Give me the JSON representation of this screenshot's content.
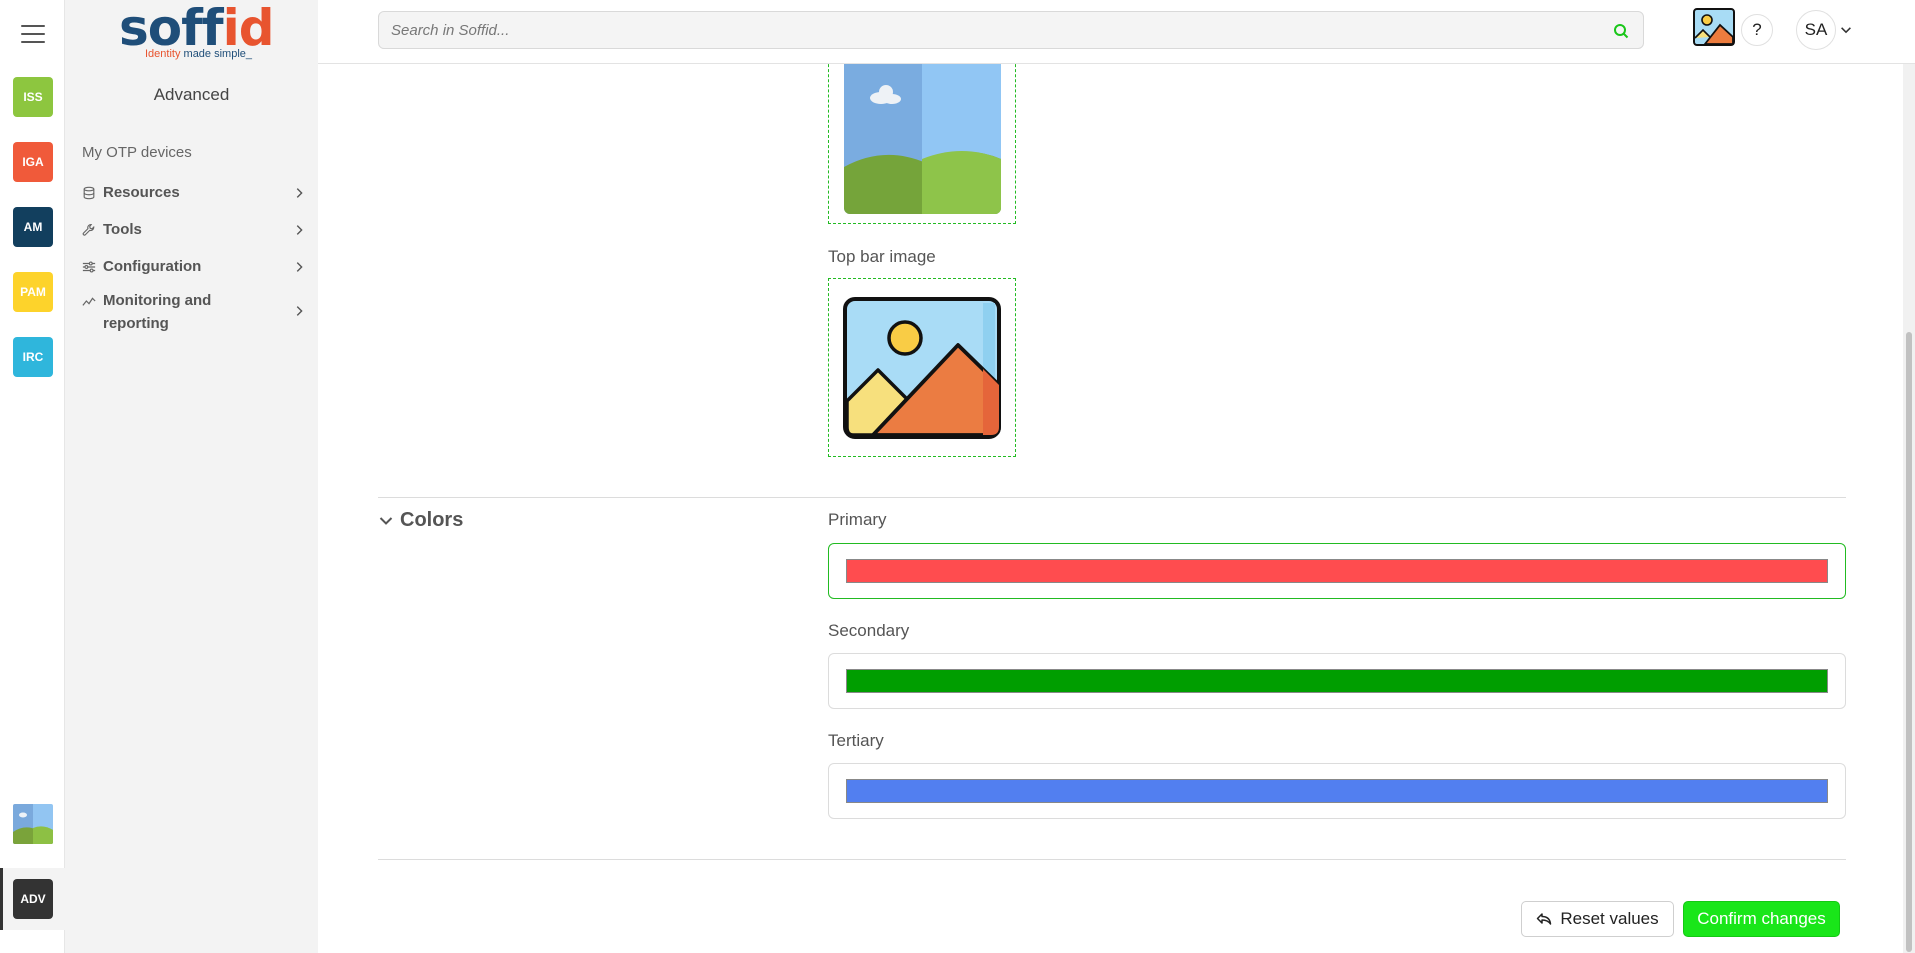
{
  "rail": {
    "apps": [
      {
        "label": "ISS",
        "color": "#8dc63f"
      },
      {
        "label": "IGA",
        "color": "#f05a3a"
      },
      {
        "label": "AM",
        "color": "#123f5e"
      },
      {
        "label": "PAM",
        "color": "#fdd32b"
      },
      {
        "label": "IRC",
        "color": "#2fb6dc"
      }
    ],
    "active_app": {
      "label": "ADV",
      "color": "#333333"
    }
  },
  "sidebar": {
    "logo": {
      "word_a": "soff",
      "word_b": "id",
      "tag_a": "Identity ",
      "tag_b": "made simple_"
    },
    "section_title": "Advanced",
    "items": [
      {
        "label": "My OTP devices",
        "icon": "none"
      },
      {
        "label": "Resources",
        "icon": "database-icon"
      },
      {
        "label": "Tools",
        "icon": "wrench-icon"
      },
      {
        "label": "Configuration",
        "icon": "sliders-icon"
      },
      {
        "label": "Monitoring and reporting",
        "icon": "chart-line-icon"
      }
    ]
  },
  "topbar": {
    "search_placeholder": "Search in Soffid...",
    "help_label": "?",
    "avatar_initials": "SA"
  },
  "main": {
    "top_bar_image_label": "Top bar image",
    "colors_section_title": "Colors",
    "colors": [
      {
        "label": "Primary",
        "value": "#ff4c4f"
      },
      {
        "label": "Secondary",
        "value": "#009e00"
      },
      {
        "label": "Tertiary",
        "value": "#527ff0"
      }
    ],
    "reset_label": "Reset values",
    "confirm_label": "Confirm changes"
  },
  "theme": {
    "accent": "#19e619",
    "dashed_border": "#22bb22"
  }
}
